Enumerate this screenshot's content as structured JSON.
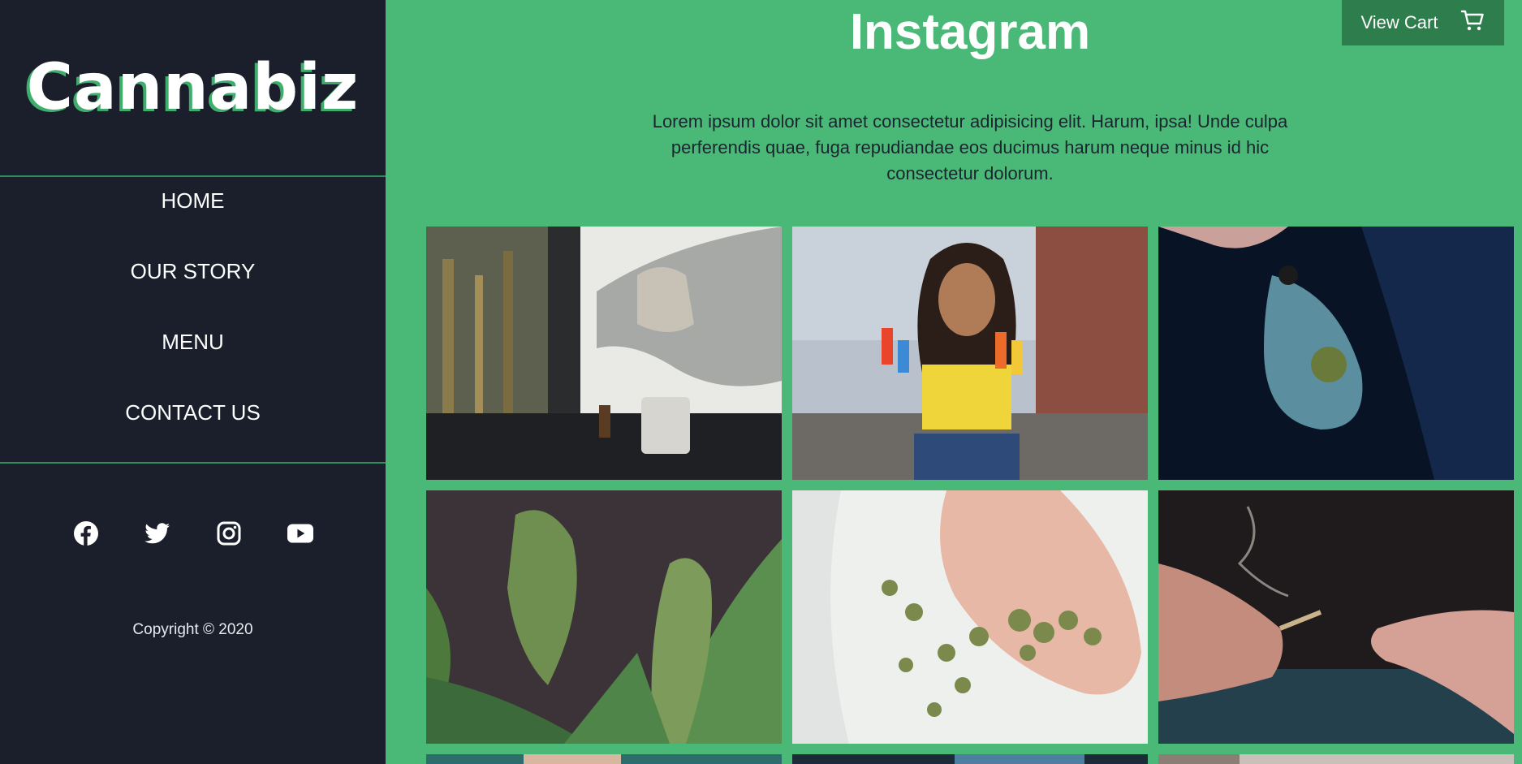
{
  "brand": {
    "logo": "Cannabiz"
  },
  "nav": {
    "items": [
      {
        "label": "HOME"
      },
      {
        "label": "OUR STORY"
      },
      {
        "label": "MENU"
      },
      {
        "label": "CONTACT US"
      }
    ]
  },
  "social": [
    "facebook-icon",
    "twitter-icon",
    "instagram-icon",
    "youtube-icon"
  ],
  "footer": {
    "copyright": "Copyright © 2020"
  },
  "header": {
    "title": "Instagram",
    "cart_label": "View Cart"
  },
  "intro": {
    "text": "Lorem ipsum dolor sit amet consectetur adipisicing elit. Harum, ipsa! Unde culpa perferendis quae, fuga repudiandae eos ducimus harum neque minus id hic consectetur dolorum."
  },
  "colors": {
    "sidebar": "#1a1f2b",
    "accent": "#4ab977",
    "divider": "#2f8d5a",
    "cart_bg": "#2e7d4c"
  }
}
